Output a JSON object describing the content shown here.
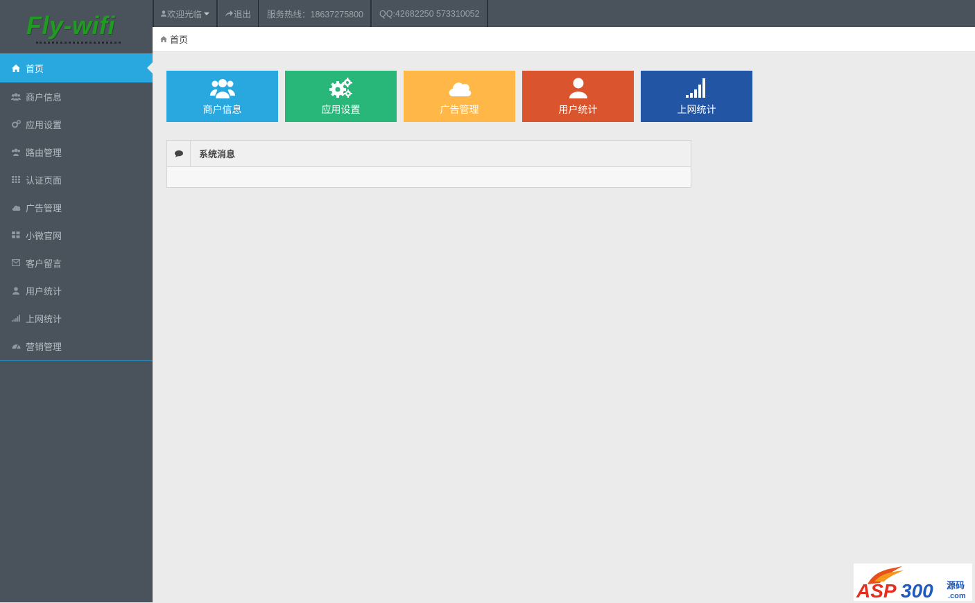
{
  "app": {
    "logo_text": "Fly-wifi",
    "brand_color": "#1f9b21"
  },
  "topbar": {
    "welcome": "欢迎光临",
    "logout": "退出",
    "hotline": "服务热线：18637275800",
    "qq": "QQ:42682250 573310052"
  },
  "breadcrumb": {
    "home": "首页"
  },
  "sidebar": {
    "items": [
      {
        "label": "首页",
        "icon": "home-icon",
        "active": true
      },
      {
        "label": "商户信息",
        "icon": "users-icon"
      },
      {
        "label": "应用设置",
        "icon": "cogs-icon"
      },
      {
        "label": "路由管理",
        "icon": "users-icon"
      },
      {
        "label": "认证页面",
        "icon": "grid-icon"
      },
      {
        "label": "广告管理",
        "icon": "cloud-icon"
      },
      {
        "label": "小微官网",
        "icon": "th-large-icon"
      },
      {
        "label": "客户留言",
        "icon": "envelope-icon"
      },
      {
        "label": "用户统计",
        "icon": "user-icon"
      },
      {
        "label": "上网统计",
        "icon": "signal-icon"
      },
      {
        "label": "营销管理",
        "icon": "dashboard-icon"
      }
    ],
    "active_color": "#29a8e0"
  },
  "tiles": [
    {
      "label": "商户信息",
      "icon": "users-icon",
      "color": "#29a8e0"
    },
    {
      "label": "应用设置",
      "icon": "cogs-icon",
      "color": "#28b779"
    },
    {
      "label": "广告管理",
      "icon": "cloud-icon",
      "color": "#ffb848"
    },
    {
      "label": "用户统计",
      "icon": "user-icon",
      "color": "#da542e"
    },
    {
      "label": "上网统计",
      "icon": "signal-icon",
      "color": "#2255a4"
    }
  ],
  "panel": {
    "title": "系统消息",
    "icon": "comment-icon"
  }
}
